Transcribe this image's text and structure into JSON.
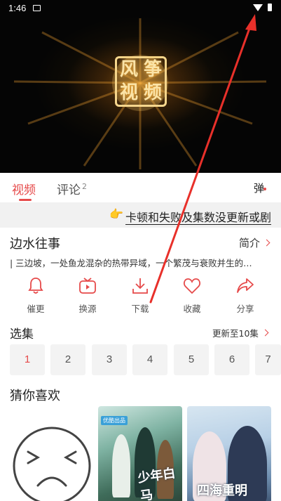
{
  "status_bar": {
    "time": "1:46"
  },
  "video": {
    "logo_chars": [
      "风",
      "筝",
      "视",
      "频"
    ]
  },
  "tabs": [
    {
      "label": "视频",
      "active": true
    },
    {
      "label": "评论",
      "count": "2",
      "active": false
    }
  ],
  "danmu_label": "弹",
  "notice": {
    "icon": "pointing-hand-icon",
    "text": "卡顿和失败及集数没更新或剧"
  },
  "show": {
    "title": "边水往事",
    "intro_label": "简介",
    "description": "| 三边坡，一处鱼龙混杂的热带异域，一个繁茂与衰败并生的…"
  },
  "actions": [
    {
      "icon": "bell-icon",
      "label": "催更"
    },
    {
      "icon": "tv-icon",
      "label": "换源"
    },
    {
      "icon": "download-icon",
      "label": "下载"
    },
    {
      "icon": "heart-icon",
      "label": "收藏"
    },
    {
      "icon": "share-icon",
      "label": "分享"
    }
  ],
  "episodes": {
    "title": "选集",
    "more_label": "更新至10集",
    "items": [
      "1",
      "2",
      "3",
      "4",
      "5",
      "6",
      "7"
    ],
    "selected": "1"
  },
  "recommend": {
    "title": "猜你喜欢",
    "posters": [
      {
        "badge": "优酷出品",
        "title_art": "少年白马"
      },
      {
        "title_art": "四海重明"
      }
    ]
  },
  "colors": {
    "accent": "#e64a4a",
    "annotation_arrow": "#e8302a",
    "notice_bg": "#f1f1f1",
    "episode_bg": "#f3f3f3"
  }
}
